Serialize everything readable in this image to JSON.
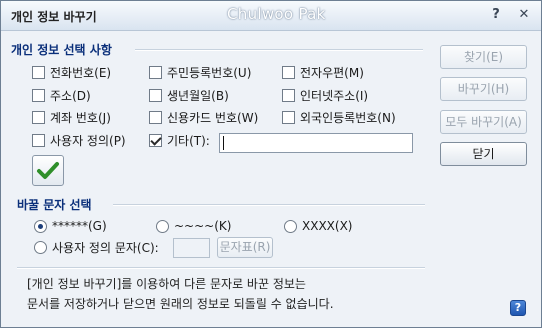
{
  "window": {
    "title": "개인 정보 바꾸기",
    "watermark": "Chulwoo Pak",
    "help_glyph": "?",
    "close_glyph": "✕"
  },
  "info_group": {
    "title": "개인 정보 선택 사항",
    "items": [
      {
        "label": "전화번호(E)",
        "checked": false
      },
      {
        "label": "주민등록번호(U)",
        "checked": false
      },
      {
        "label": "전자우편(M)",
        "checked": false
      },
      {
        "label": "주소(D)",
        "checked": false
      },
      {
        "label": "생년월일(B)",
        "checked": false
      },
      {
        "label": "인터넷주소(I)",
        "checked": false
      },
      {
        "label": "계좌 번호(J)",
        "checked": false
      },
      {
        "label": "신용카드 번호(W)",
        "checked": false
      },
      {
        "label": "외국인등록번호(N)",
        "checked": false
      },
      {
        "label": "사용자 정의(P)",
        "checked": false
      },
      {
        "label": "기타(T):",
        "checked": true
      }
    ],
    "other_value": ""
  },
  "side_buttons": {
    "find": "찾기(E)",
    "replace": "바꾸기(H)",
    "replace_all": "모두 바꾸기(A)",
    "close": "닫기"
  },
  "replace_group": {
    "title": "바꿀 문자 선택",
    "options": [
      {
        "label": "******(G)",
        "selected": true
      },
      {
        "label": "~~~~(K)",
        "selected": false
      },
      {
        "label": "XXXX(X)",
        "selected": false
      }
    ],
    "custom_label": "사용자 정의 문자(C):",
    "custom_value": "",
    "charmap_label": "문자표(R)"
  },
  "notice": {
    "line1": "[개인 정보 바꾸기]를 이용하여 다른 문자로 바꾼 정보는",
    "line2": "문서를 저장하거나 닫으면 원래의 정보로 되돌릴 수 없습니다."
  },
  "help_icon_glyph": "?"
}
